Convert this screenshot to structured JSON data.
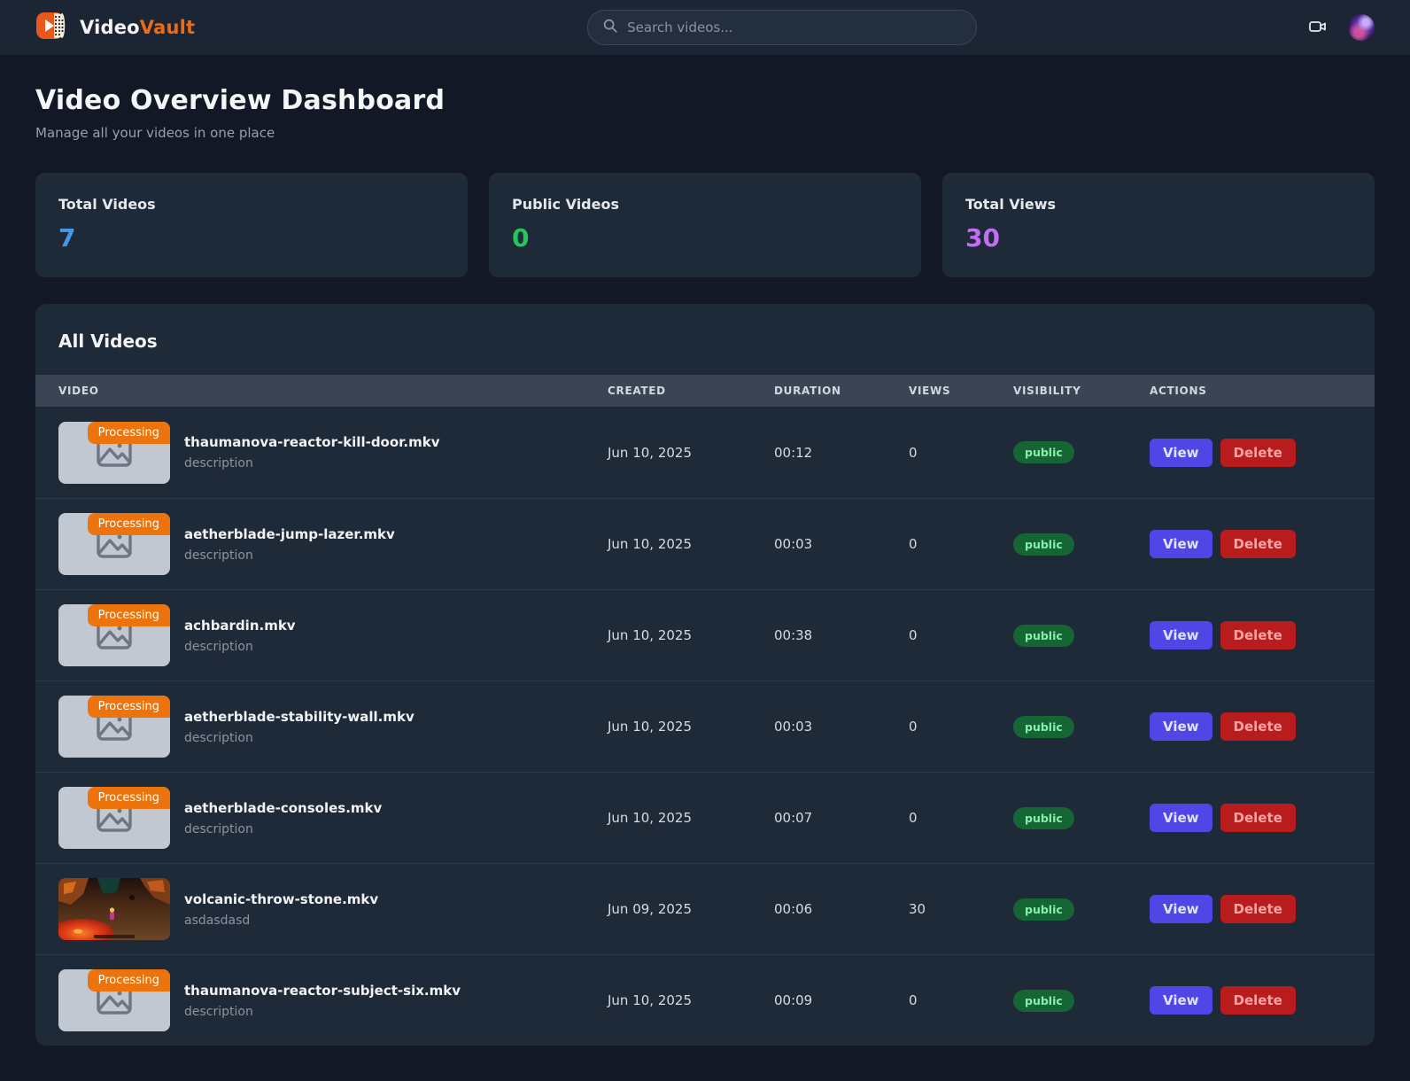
{
  "nav": {
    "brand": {
      "video": "Video",
      "vault": "Vault"
    },
    "search_placeholder": "Search videos...",
    "icons": {
      "logo": "play-film-reel-icon",
      "camera": "video-camera-icon",
      "search": "search-icon"
    }
  },
  "page": {
    "title": "Video Overview Dashboard",
    "subtitle": "Manage all your videos in one place"
  },
  "stats": [
    {
      "label": "Total Videos",
      "value": "7",
      "color": "#4796e8"
    },
    {
      "label": "Public Videos",
      "value": "0",
      "color": "#22c55e"
    },
    {
      "label": "Total Views",
      "value": "30",
      "color": "#c26ef2"
    }
  ],
  "table": {
    "title": "All Videos",
    "columns": [
      "VIDEO",
      "CREATED",
      "DURATION",
      "VIEWS",
      "VISIBILITY",
      "ACTIONS"
    ],
    "processing_label": "Processing",
    "actions": {
      "view": "View",
      "delete": "Delete"
    },
    "rows": [
      {
        "title": "thaumanova-reactor-kill-door.mkv",
        "description": "description",
        "created": "Jun 10, 2025",
        "duration": "00:12",
        "views": "0",
        "visibility": "public",
        "thumbnail": "processing"
      },
      {
        "title": "aetherblade-jump-lazer.mkv",
        "description": "description",
        "created": "Jun 10, 2025",
        "duration": "00:03",
        "views": "0",
        "visibility": "public",
        "thumbnail": "processing"
      },
      {
        "title": "achbardin.mkv",
        "description": "description",
        "created": "Jun 10, 2025",
        "duration": "00:38",
        "views": "0",
        "visibility": "public",
        "thumbnail": "processing"
      },
      {
        "title": "aetherblade-stability-wall.mkv",
        "description": "description",
        "created": "Jun 10, 2025",
        "duration": "00:03",
        "views": "0",
        "visibility": "public",
        "thumbnail": "processing"
      },
      {
        "title": "aetherblade-consoles.mkv",
        "description": "description",
        "created": "Jun 10, 2025",
        "duration": "00:07",
        "views": "0",
        "visibility": "public",
        "thumbnail": "processing"
      },
      {
        "title": "volcanic-throw-stone.mkv",
        "description": "asdasdasd",
        "created": "Jun 09, 2025",
        "duration": "00:06",
        "views": "30",
        "visibility": "public",
        "thumbnail": "volcano"
      },
      {
        "title": "thaumanova-reactor-subject-six.mkv",
        "description": "description",
        "created": "Jun 10, 2025",
        "duration": "00:09",
        "views": "0",
        "visibility": "public",
        "thumbnail": "processing"
      }
    ]
  }
}
